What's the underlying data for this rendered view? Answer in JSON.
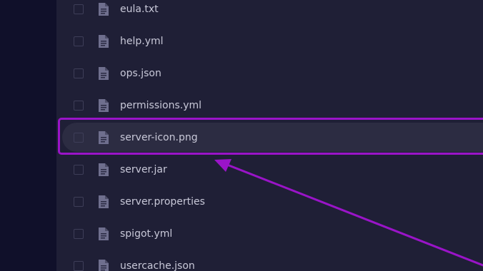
{
  "files": [
    {
      "name": "eula.txt",
      "selected": false
    },
    {
      "name": "help.yml",
      "selected": false
    },
    {
      "name": "ops.json",
      "selected": false
    },
    {
      "name": "permissions.yml",
      "selected": false
    },
    {
      "name": "server-icon.png",
      "selected": true
    },
    {
      "name": "server.jar",
      "selected": false
    },
    {
      "name": "server.properties",
      "selected": false
    },
    {
      "name": "spigot.yml",
      "selected": false
    },
    {
      "name": "usercache.json",
      "selected": false
    }
  ],
  "icons": {
    "checkbox": "checkbox-icon",
    "file": "document-icon"
  },
  "colors": {
    "background": "#1f1f36",
    "left_rail": "#10102a",
    "row_highlight": "#2c2c42",
    "annotation": "#9a14c8",
    "text": "#c8c8d8"
  }
}
